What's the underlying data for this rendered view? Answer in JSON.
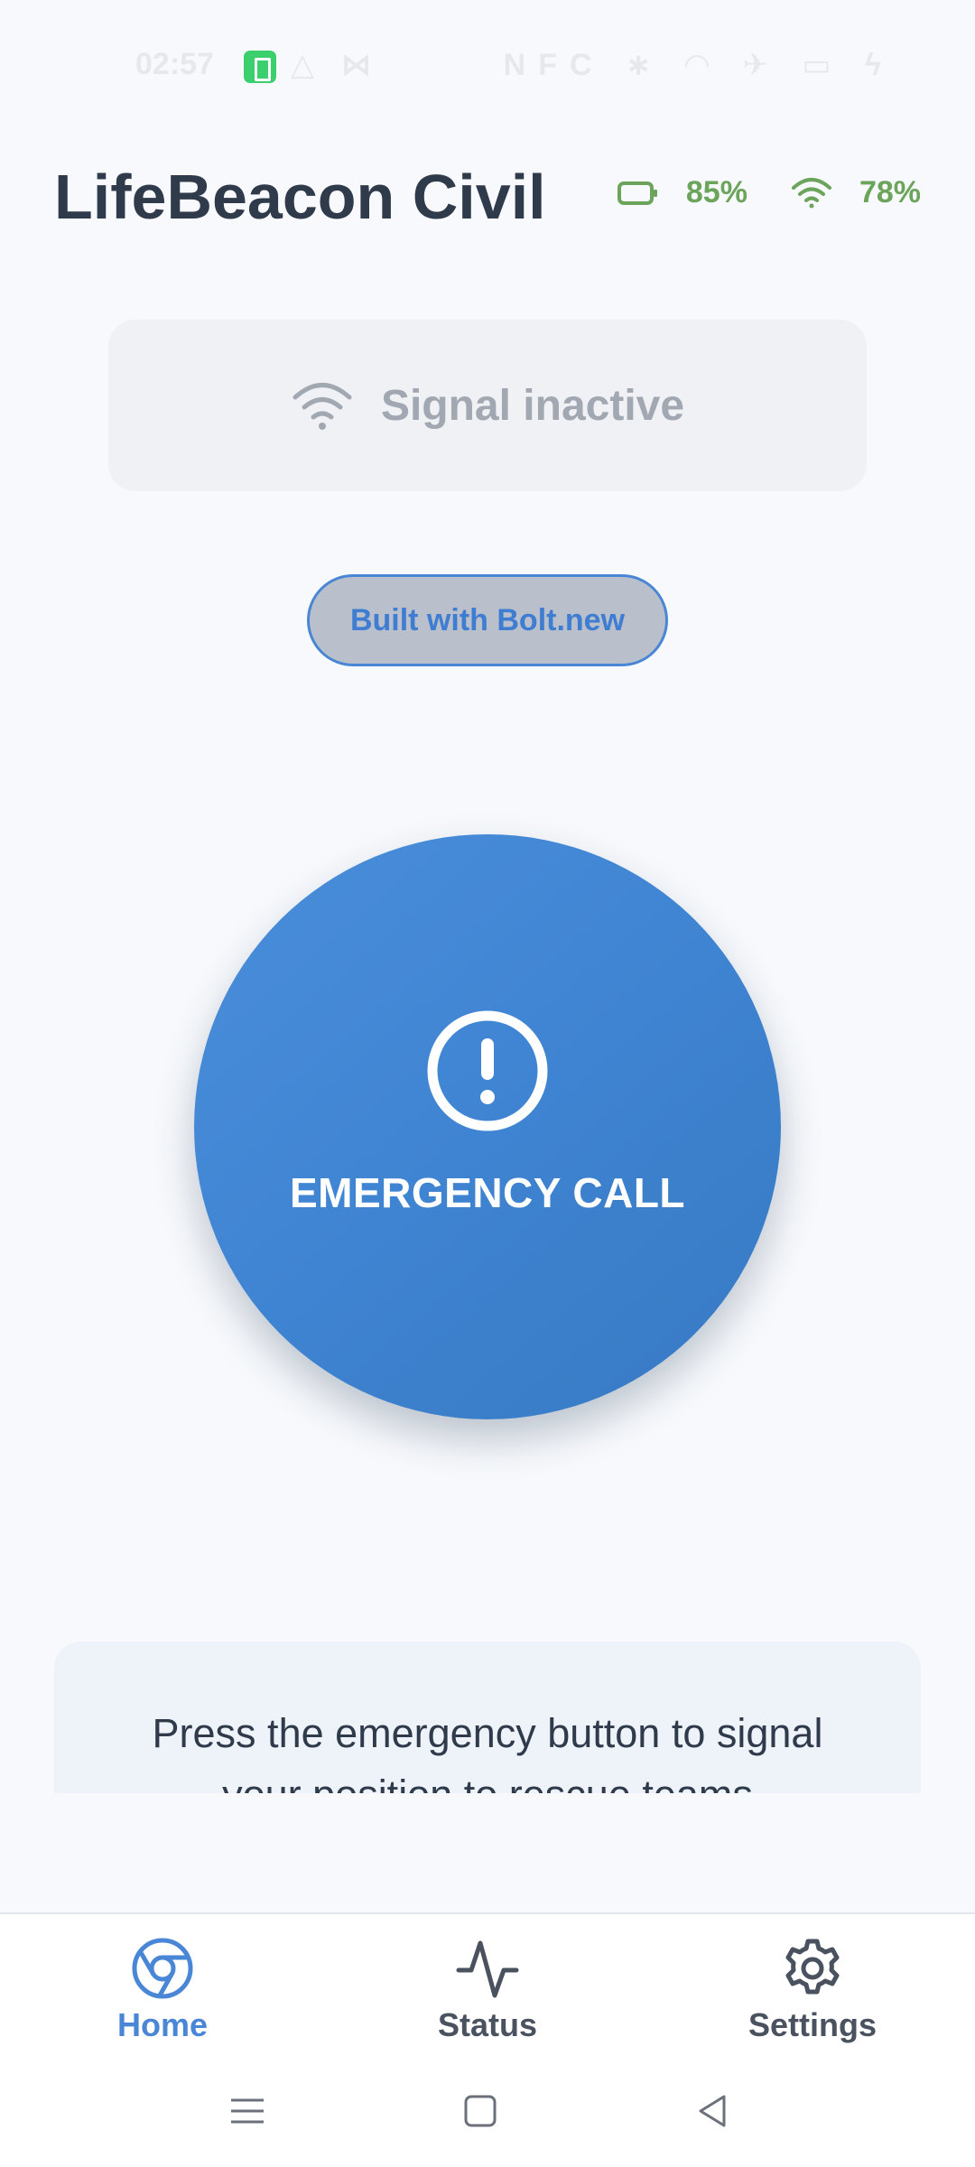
{
  "status_bar": {
    "time": "02:57",
    "left_icons": "△ ⋈",
    "right_icons": "NFC ∗ ◠ ✈ ▭ ϟ"
  },
  "header": {
    "title": "LifeBeacon Civil",
    "battery": "85%",
    "signal": "78%",
    "stats_color": "#6ba45a"
  },
  "signal_status": {
    "label": "Signal inactive",
    "icon": "wifi-icon"
  },
  "bolt_badge": {
    "label": "Built with Bolt.new"
  },
  "emergency": {
    "label": "EMERGENCY CALL",
    "icon": "alert-circle-icon",
    "color": "#4085d3"
  },
  "instruction": {
    "text": "Press the emergency button to signal your position to rescue teams"
  },
  "bottom_nav": {
    "items": [
      {
        "label": "Home",
        "icon": "chrome-icon",
        "active": true
      },
      {
        "label": "Status",
        "icon": "activity-icon",
        "active": false
      },
      {
        "label": "Settings",
        "icon": "gear-icon",
        "active": false
      }
    ],
    "accent": "#4a86d6"
  },
  "system_nav": {
    "buttons": [
      "menu",
      "home",
      "back"
    ]
  }
}
